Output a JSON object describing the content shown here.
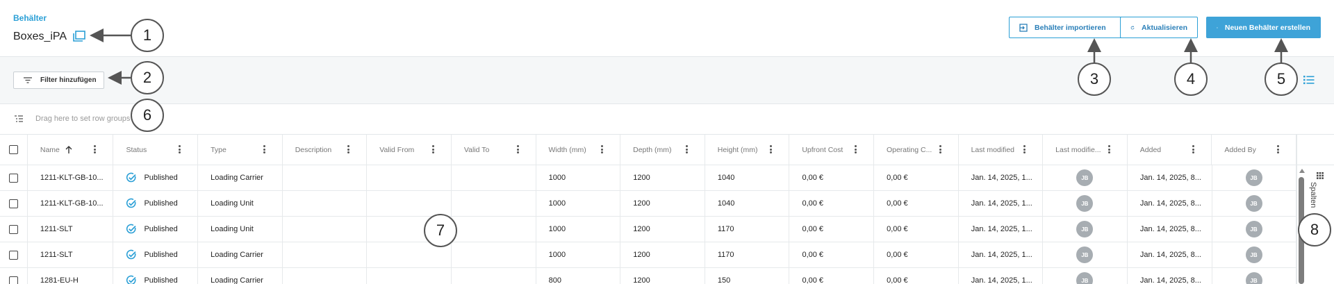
{
  "header": {
    "breadcrumb": "Behälter",
    "title": "Boxes_iPA",
    "title_icon": "folder-stack-icon",
    "buttons": {
      "import_label": "Behälter importieren",
      "refresh_label": "Aktualisieren",
      "create_label": "Neuen Behälter erstellen"
    }
  },
  "filterbar": {
    "filter_label": "Filter hinzufügen",
    "view_icon": "list-view-icon"
  },
  "groupbar": {
    "placeholder": "Drag here to set row groups"
  },
  "table": {
    "columns": [
      "Name",
      "Status",
      "Type",
      "Description",
      "Valid From",
      "Valid To",
      "Width (mm)",
      "Depth (mm)",
      "Height (mm)",
      "Upfront Cost",
      "Operating C...",
      "Last modified",
      "Last modifie...",
      "Added",
      "Added By"
    ],
    "sort": {
      "column": "Name",
      "direction": "ascending"
    },
    "rows": [
      {
        "name": "1211-KLT-GB-10...",
        "status": "Published",
        "type": "Loading Carrier",
        "description": "",
        "valid_from": "",
        "valid_to": "",
        "width": "1000",
        "depth": "1200",
        "height": "1040",
        "upfront_cost": "0,00 €",
        "operating_cost": "0,00 €",
        "last_modified": "Jan. 14, 2025, 1...",
        "last_modified_by": "JB",
        "added": "Jan. 14, 2025, 8...",
        "added_by": "JB"
      },
      {
        "name": "1211-KLT-GB-10...",
        "status": "Published",
        "type": "Loading Unit",
        "description": "",
        "valid_from": "",
        "valid_to": "",
        "width": "1000",
        "depth": "1200",
        "height": "1040",
        "upfront_cost": "0,00 €",
        "operating_cost": "0,00 €",
        "last_modified": "Jan. 14, 2025, 1...",
        "last_modified_by": "JB",
        "added": "Jan. 14, 2025, 8...",
        "added_by": "JB"
      },
      {
        "name": "1211-SLT",
        "status": "Published",
        "type": "Loading Unit",
        "description": "",
        "valid_from": "",
        "valid_to": "",
        "width": "1000",
        "depth": "1200",
        "height": "1170",
        "upfront_cost": "0,00 €",
        "operating_cost": "0,00 €",
        "last_modified": "Jan. 14, 2025, 1...",
        "last_modified_by": "JB",
        "added": "Jan. 14, 2025, 8...",
        "added_by": "JB"
      },
      {
        "name": "1211-SLT",
        "status": "Published",
        "type": "Loading Carrier",
        "description": "",
        "valid_from": "",
        "valid_to": "",
        "width": "1000",
        "depth": "1200",
        "height": "1170",
        "upfront_cost": "0,00 €",
        "operating_cost": "0,00 €",
        "last_modified": "Jan. 14, 2025, 1...",
        "last_modified_by": "JB",
        "added": "Jan. 14, 2025, 8...",
        "added_by": "JB"
      },
      {
        "name": "1281-EU-H",
        "status": "Published",
        "type": "Loading Carrier",
        "description": "",
        "valid_from": "",
        "valid_to": "",
        "width": "800",
        "depth": "1200",
        "height": "150",
        "upfront_cost": "0,00 €",
        "operating_cost": "0,00 €",
        "last_modified": "Jan. 14, 2025, 1...",
        "last_modified_by": "JB",
        "added": "Jan. 14, 2025, 8...",
        "added_by": "JB"
      }
    ]
  },
  "sidepanel": {
    "columns_label": "Spalten",
    "columns_icon": "grid-icon"
  },
  "callouts": [
    "1",
    "2",
    "3",
    "4",
    "5",
    "6",
    "7",
    "8"
  ],
  "colors": {
    "accent": "#2a9fd6",
    "primary_button": "#3ea3d8",
    "filter_bar_bg": "#f5f7f8",
    "avatar_bg": "#a7adb2"
  }
}
